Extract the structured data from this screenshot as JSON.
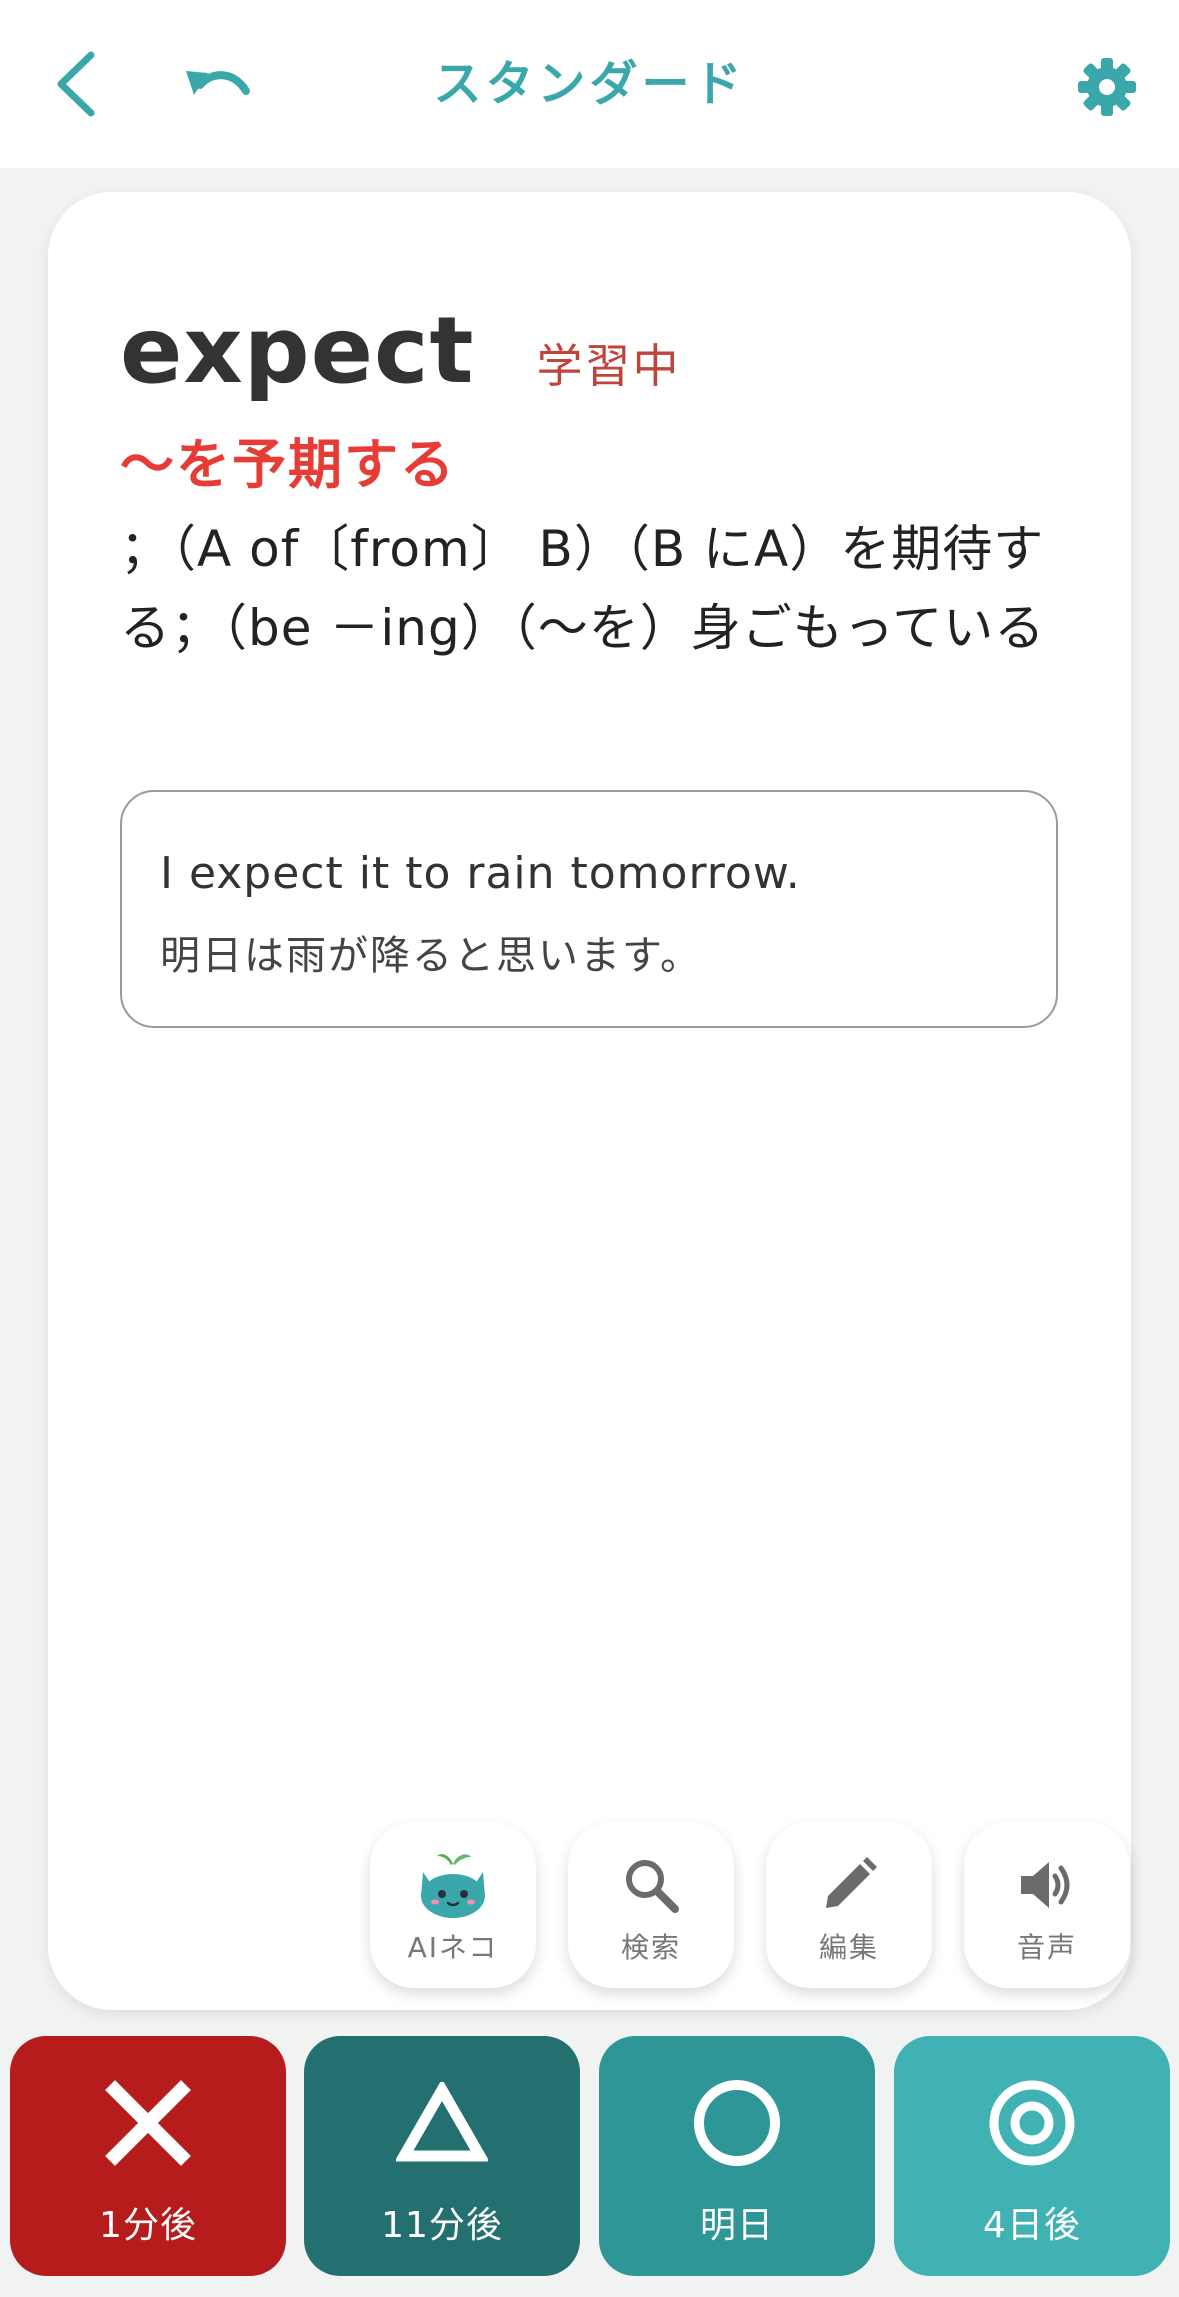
{
  "header": {
    "title": "スタンダード",
    "back_icon": "chevron-left-icon",
    "undo_icon": "undo-icon",
    "settings_icon": "gear-icon",
    "accent_color": "#3aa8ab"
  },
  "card": {
    "word": "expect",
    "status": "学習中",
    "meaning_main": "〜を予期する",
    "meaning_detail": "；（A of〔from〕 B）（B にA）を期待する；（be －ing）（〜を）身ごもっている",
    "example": {
      "en": "I expect it to rain tomorrow.",
      "ja": "明日は雨が降ると思います。"
    }
  },
  "actions": [
    {
      "label": "AIネコ",
      "icon": "cat-icon"
    },
    {
      "label": "検索",
      "icon": "search-icon"
    },
    {
      "label": "編集",
      "icon": "pencil-icon"
    },
    {
      "label": "音声",
      "icon": "speaker-icon"
    }
  ],
  "grades": [
    {
      "label": "1分後",
      "icon": "cross-icon",
      "color": "#b71c1c"
    },
    {
      "label": "11分後",
      "icon": "triangle-icon",
      "color": "#246f70"
    },
    {
      "label": "明日",
      "icon": "circle-icon",
      "color": "#2e9697"
    },
    {
      "label": "4日後",
      "icon": "double-circle-icon",
      "color": "#41b2b3"
    }
  ]
}
